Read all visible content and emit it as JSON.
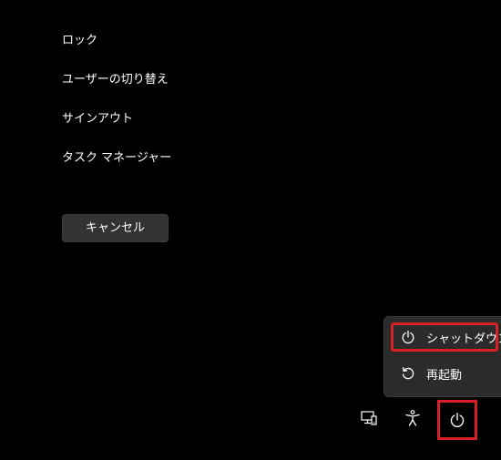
{
  "menu": {
    "lock": "ロック",
    "switch_user": "ユーザーの切り替え",
    "sign_out": "サインアウト",
    "task_manager": "タスク マネージャー"
  },
  "cancel_label": "キャンセル",
  "power_menu": {
    "shutdown": {
      "label": "シャットダウン",
      "icon": "power-icon"
    },
    "restart": {
      "label": "再起動",
      "icon": "restart-icon"
    }
  },
  "tray": {
    "network_icon": "network-icon",
    "accessibility_icon": "accessibility-icon",
    "power_icon": "power-icon"
  },
  "colors": {
    "background": "#000000",
    "highlight": "#d71f26",
    "menu_bg": "#2b2b2b",
    "button_bg": "#333333"
  }
}
